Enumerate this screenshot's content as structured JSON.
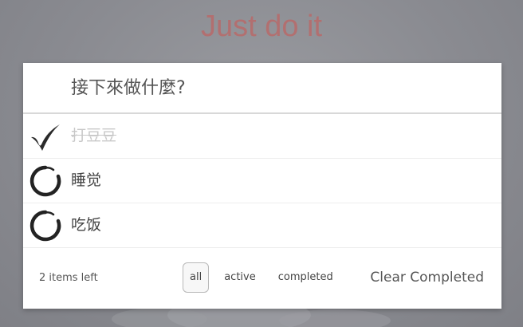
{
  "app": {
    "title": "Just do it"
  },
  "new_todo": {
    "placeholder": "接下來做什麼?"
  },
  "todos": [
    {
      "text": "打豆豆",
      "completed": true
    },
    {
      "text": "睡觉",
      "completed": false
    },
    {
      "text": "吃饭",
      "completed": false
    }
  ],
  "footer": {
    "items_left": "2 items left",
    "filters": [
      "all",
      "active",
      "completed"
    ],
    "selected_filter": "all",
    "clear_label": "Clear Completed"
  },
  "colors": {
    "title": "#b86a6a",
    "background": "#8a8b91",
    "panel": "#ffffff"
  },
  "icons": {
    "completed": "checkmark-brush-icon",
    "active": "circle-brush-icon"
  }
}
